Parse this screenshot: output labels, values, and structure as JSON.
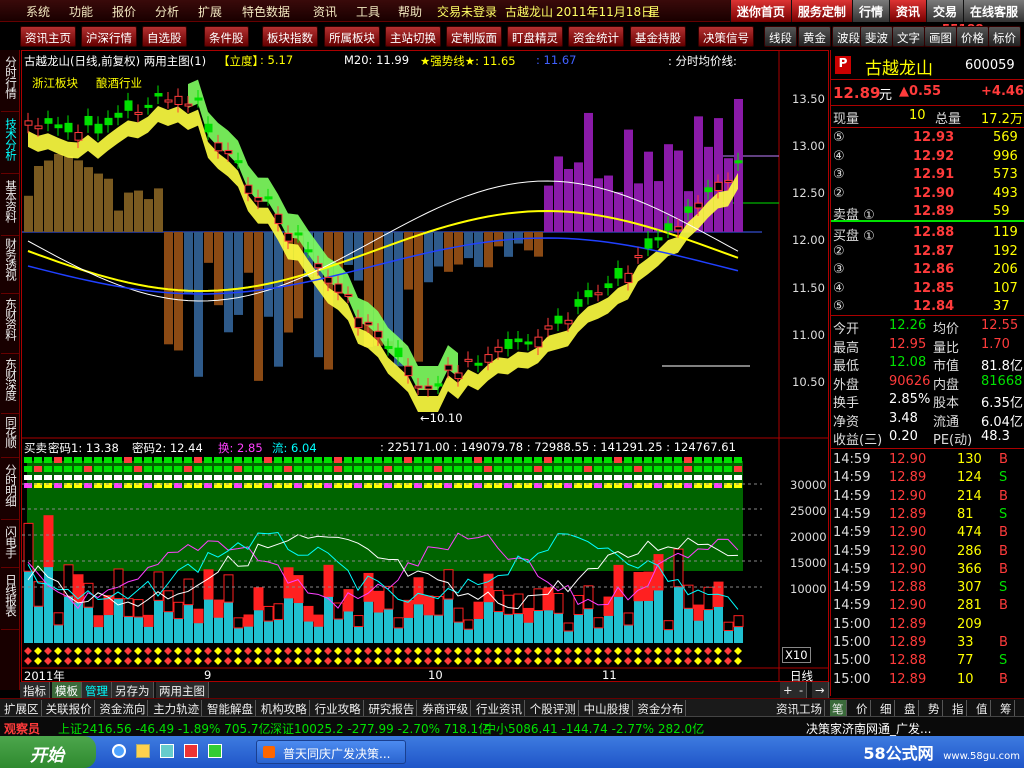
{
  "menu": {
    "items": [
      "系统",
      "功能",
      "报价",
      "分析",
      "扩展",
      "特色数据",
      "资讯",
      "工具",
      "帮助"
    ],
    "login_status": "交易未登录",
    "stock_name": "古越龙山",
    "date": "2011年11月18日",
    "weekday": "星",
    "top_buttons": [
      "迷你首页",
      "服务定制",
      "行情",
      "资讯",
      "交易",
      "在线客服"
    ],
    "site_url": "www.55188.com"
  },
  "toolbar": {
    "buttons": [
      "资讯主页",
      "沪深行情",
      "自选股",
      "条件股",
      "板块指数",
      "所属板块",
      "主站切换",
      "定制版面",
      "盯盘精灵",
      "资金统计",
      "基金持股",
      "决策信号"
    ],
    "right_buttons": [
      "线段",
      "黄金",
      "波段",
      "斐波",
      "文字",
      "画图",
      "价格",
      "标价"
    ]
  },
  "left_tabs": [
    "分时行情",
    "技术分析",
    "基本资料",
    "财务透视",
    "东财资料",
    "东财深度",
    "同花顺",
    "分时明细",
    "闪电手",
    "日线报表"
  ],
  "main_chart": {
    "header": "古越龙山(日线,前复权) 两用主图(1)",
    "tag": "【立度】",
    "tag_value": ": 5.17",
    "m20": "M20: 11.99",
    "strong_line": "★强势线★: 11.65",
    "value3": ": 11.67",
    "avg_price_line": ": 分时均价线:",
    "sector1": "浙江板块",
    "sector2": "酿酒行业",
    "low_mark": "←10.10",
    "y_ticks": [
      "13.50",
      "13.00",
      "12.50",
      "12.00",
      "11.50",
      "11.00",
      "10.50"
    ]
  },
  "sub_chart": {
    "header": "买卖",
    "code1": "密码1: 13.38",
    "code2": "密码2: 12.44",
    "huan": "换: 2.85",
    "liu": "流: 6.04",
    "values": ": 225171.00 : 149079.78 : 72988.55 : 141291.25 : 124767.61",
    "y_ticks": [
      "30000",
      "25000",
      "20000",
      "15000",
      "10000"
    ],
    "x10": "X10"
  },
  "time_axis": {
    "year_label": "2011年",
    "month9": "9",
    "month10": "10",
    "month11": "11",
    "period": "日线"
  },
  "quote": {
    "code_badge": "P",
    "name": "古越龙山",
    "code": "600059",
    "price": "12.89",
    "unit": "元",
    "change": "▲0.55",
    "pct": "+4.46",
    "xianliang_label": "现量",
    "xianliang": "10",
    "zongliang_label": "总量",
    "zongliang": "17.2万",
    "sell": [
      {
        "n": "⑤",
        "p": "12.93",
        "v": "569"
      },
      {
        "n": "④",
        "p": "12.92",
        "v": "996"
      },
      {
        "n": "③",
        "p": "12.91",
        "v": "573"
      },
      {
        "n": "②",
        "p": "12.90",
        "v": "493"
      },
      {
        "n": "卖盘 ①",
        "p": "12.89",
        "v": "59"
      }
    ],
    "buy": [
      {
        "n": "买盘 ①",
        "p": "12.88",
        "v": "119"
      },
      {
        "n": "②",
        "p": "12.87",
        "v": "192"
      },
      {
        "n": "③",
        "p": "12.86",
        "v": "206"
      },
      {
        "n": "④",
        "p": "12.85",
        "v": "107"
      },
      {
        "n": "⑤",
        "p": "12.84",
        "v": "37"
      }
    ],
    "stats": [
      [
        "今开",
        "12.26",
        "均价",
        "12.55"
      ],
      [
        "最高",
        "12.95",
        "量比",
        "1.70"
      ],
      [
        "最低",
        "12.08",
        "市值",
        "81.8亿"
      ],
      [
        "外盘",
        "90626",
        "内盘",
        "81668"
      ],
      [
        "换手",
        "2.85%",
        "股本",
        "6.35亿"
      ],
      [
        "净资",
        "3.48",
        "流通",
        "6.04亿"
      ],
      [
        "收益(三)",
        "0.20",
        "PE(动)",
        "48.3"
      ]
    ],
    "ticks": [
      [
        "14:59",
        "12.90",
        "130",
        "B"
      ],
      [
        "14:59",
        "12.89",
        "124",
        "S"
      ],
      [
        "14:59",
        "12.90",
        "214",
        "B"
      ],
      [
        "14:59",
        "12.89",
        "81",
        "S"
      ],
      [
        "14:59",
        "12.90",
        "474",
        "B"
      ],
      [
        "14:59",
        "12.90",
        "286",
        "B"
      ],
      [
        "14:59",
        "12.90",
        "366",
        "B"
      ],
      [
        "14:59",
        "12.88",
        "307",
        "S"
      ],
      [
        "14:59",
        "12.90",
        "281",
        "B"
      ],
      [
        "15:00",
        "12.89",
        "209",
        ""
      ],
      [
        "15:00",
        "12.89",
        "33",
        "B"
      ],
      [
        "15:00",
        "12.88",
        "77",
        "S"
      ],
      [
        "15:00",
        "12.89",
        "10",
        "B"
      ]
    ],
    "bottom_tabs": [
      "笔",
      "价",
      "细",
      "盘",
      "势",
      "指",
      "值",
      "筹"
    ]
  },
  "bottom_tabs": [
    "指标",
    "模板",
    "管理",
    "另存为",
    "两用主图"
  ],
  "zoom_controls": [
    "+",
    "-",
    "→"
  ],
  "func_tabs": [
    "扩展区",
    "关联报价",
    "资金流向",
    "主力轨迹",
    "智能解盘",
    "机构攻略",
    "行业攻略",
    "研究报告",
    "券商评级",
    "行业资讯",
    "个股评测",
    "中山股搜",
    "资金分布"
  ],
  "func_right": "资讯工场",
  "index_bar": {
    "label": "观察员",
    "sh": "上证2416.56  -46.49  -1.89%  705.7亿",
    "sz": "深证10025.2  -277.99  -2.70%  718.1亿",
    "zx": "中小5086.41  -144.74  -2.77%  282.0亿",
    "news": "决策家济南网通_广发..."
  },
  "taskbar": {
    "start": "开始",
    "task": "普天同庆广发决策...",
    "brand": "58公式网",
    "brand_url": "www.58gu.com"
  },
  "colors": {
    "up": "#ff3b3b",
    "down": "#00e000",
    "yellow": "#ffff00",
    "cyan": "#00ffff"
  }
}
